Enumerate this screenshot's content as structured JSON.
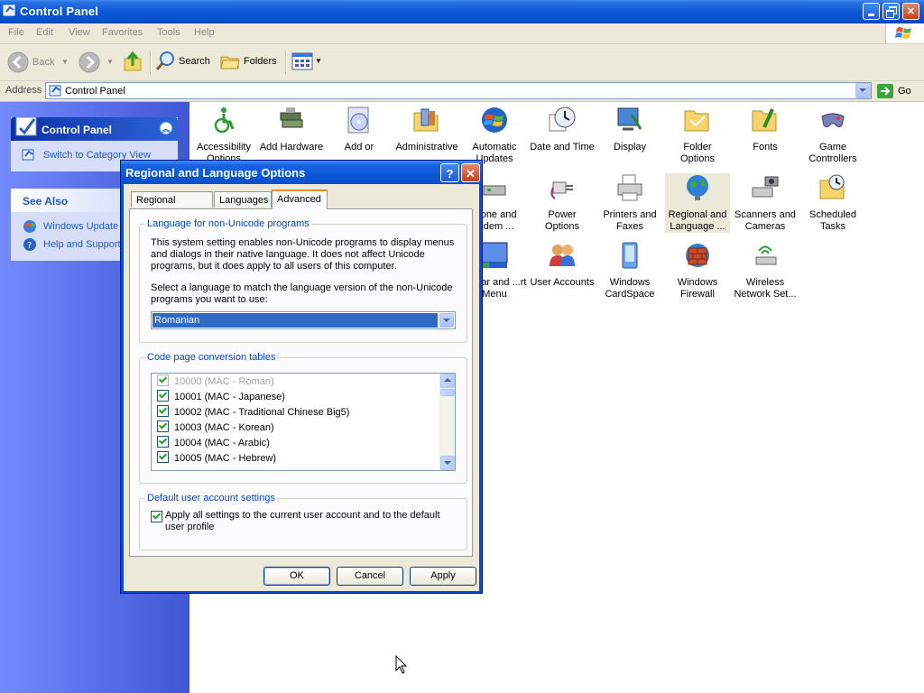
{
  "window": {
    "title": "Control Panel"
  },
  "menu": [
    "File",
    "Edit",
    "View",
    "Favorites",
    "Tools",
    "Help"
  ],
  "toolbar": {
    "back": "Back",
    "search": "Search",
    "folders": "Folders"
  },
  "address": {
    "label": "Address",
    "value": "Control Panel",
    "go": "Go"
  },
  "leftpane": {
    "cp_title": "Control Panel",
    "switch_view": "Switch to Category View",
    "see_also_title": "See Also",
    "see_also": [
      "Windows Update",
      "Help and Support"
    ]
  },
  "icons": [
    {
      "label": "Accessibility Options",
      "icon": "accessibility-icon"
    },
    {
      "label": "Add Hardware",
      "icon": "hardware-icon"
    },
    {
      "label": "Add or Remov...",
      "icon": "cd-icon"
    },
    {
      "label": "Administrative Tools",
      "icon": "admin-tools-icon"
    },
    {
      "label": "Automatic Updates",
      "icon": "windows-logo-icon"
    },
    {
      "label": "Date and Time",
      "icon": "clock-icon"
    },
    {
      "label": "Display",
      "icon": "display-icon"
    },
    {
      "label": "Folder Options",
      "icon": "folder-icon"
    },
    {
      "label": "Fonts",
      "icon": "fonts-folder-icon"
    },
    {
      "label": "Game Controllers",
      "icon": "gamepad-icon"
    },
    {
      "label": "...one and ...dem ...",
      "icon": "modem-icon"
    },
    {
      "label": "Power Options",
      "icon": "power-icon"
    },
    {
      "label": "Printers and Faxes",
      "icon": "printer-icon"
    },
    {
      "label": "Regional and Language ...",
      "icon": "globe-icon"
    },
    {
      "label": "Scanners and Cameras",
      "icon": "scanner-icon"
    },
    {
      "label": "Scheduled Tasks",
      "icon": "scheduled-tasks-icon"
    },
    {
      "label": "...kbar and ...rt Menu",
      "icon": "taskbar-icon"
    },
    {
      "label": "User Accounts",
      "icon": "users-icon"
    },
    {
      "label": "Windows CardSpace",
      "icon": "cardspace-icon"
    },
    {
      "label": "Windows Firewall",
      "icon": "firewall-icon"
    },
    {
      "label": "Wireless Network Set...",
      "icon": "wireless-icon"
    }
  ],
  "dialog": {
    "title": "Regional and Language Options",
    "tabs": [
      "Regional Options",
      "Languages",
      "Advanced"
    ],
    "active_tab": "Advanced",
    "group1": {
      "legend": "Language for non-Unicode programs",
      "desc1": "This system setting enables non-Unicode programs to display menus and dialogs in their native language. It does not affect Unicode programs, but it does apply to all users of this computer.",
      "desc2": "Select a language to match the language version of the non-Unicode programs you want to use:",
      "selected_language": "Romanian"
    },
    "group2": {
      "legend": "Code page conversion tables",
      "items": [
        {
          "label": "10000 (MAC - Roman)",
          "disabled": true
        },
        {
          "label": "10001 (MAC - Japanese)",
          "disabled": false
        },
        {
          "label": "10002 (MAC - Traditional Chinese Big5)",
          "disabled": false
        },
        {
          "label": "10003 (MAC - Korean)",
          "disabled": false
        },
        {
          "label": "10004 (MAC - Arabic)",
          "disabled": false
        },
        {
          "label": "10005 (MAC - Hebrew)",
          "disabled": false
        }
      ]
    },
    "group3": {
      "legend": "Default user account settings",
      "checkbox_label": "Apply all settings to the current user account and to the default user profile"
    },
    "buttons": {
      "ok": "OK",
      "cancel": "Cancel",
      "apply": "Apply"
    }
  },
  "colors": {
    "titlebar": "#0a58d8",
    "leftpane": "#6375d6",
    "dialog_bg": "#ece9d8",
    "selection": "#316ac5",
    "group_legend": "#0046d5"
  }
}
